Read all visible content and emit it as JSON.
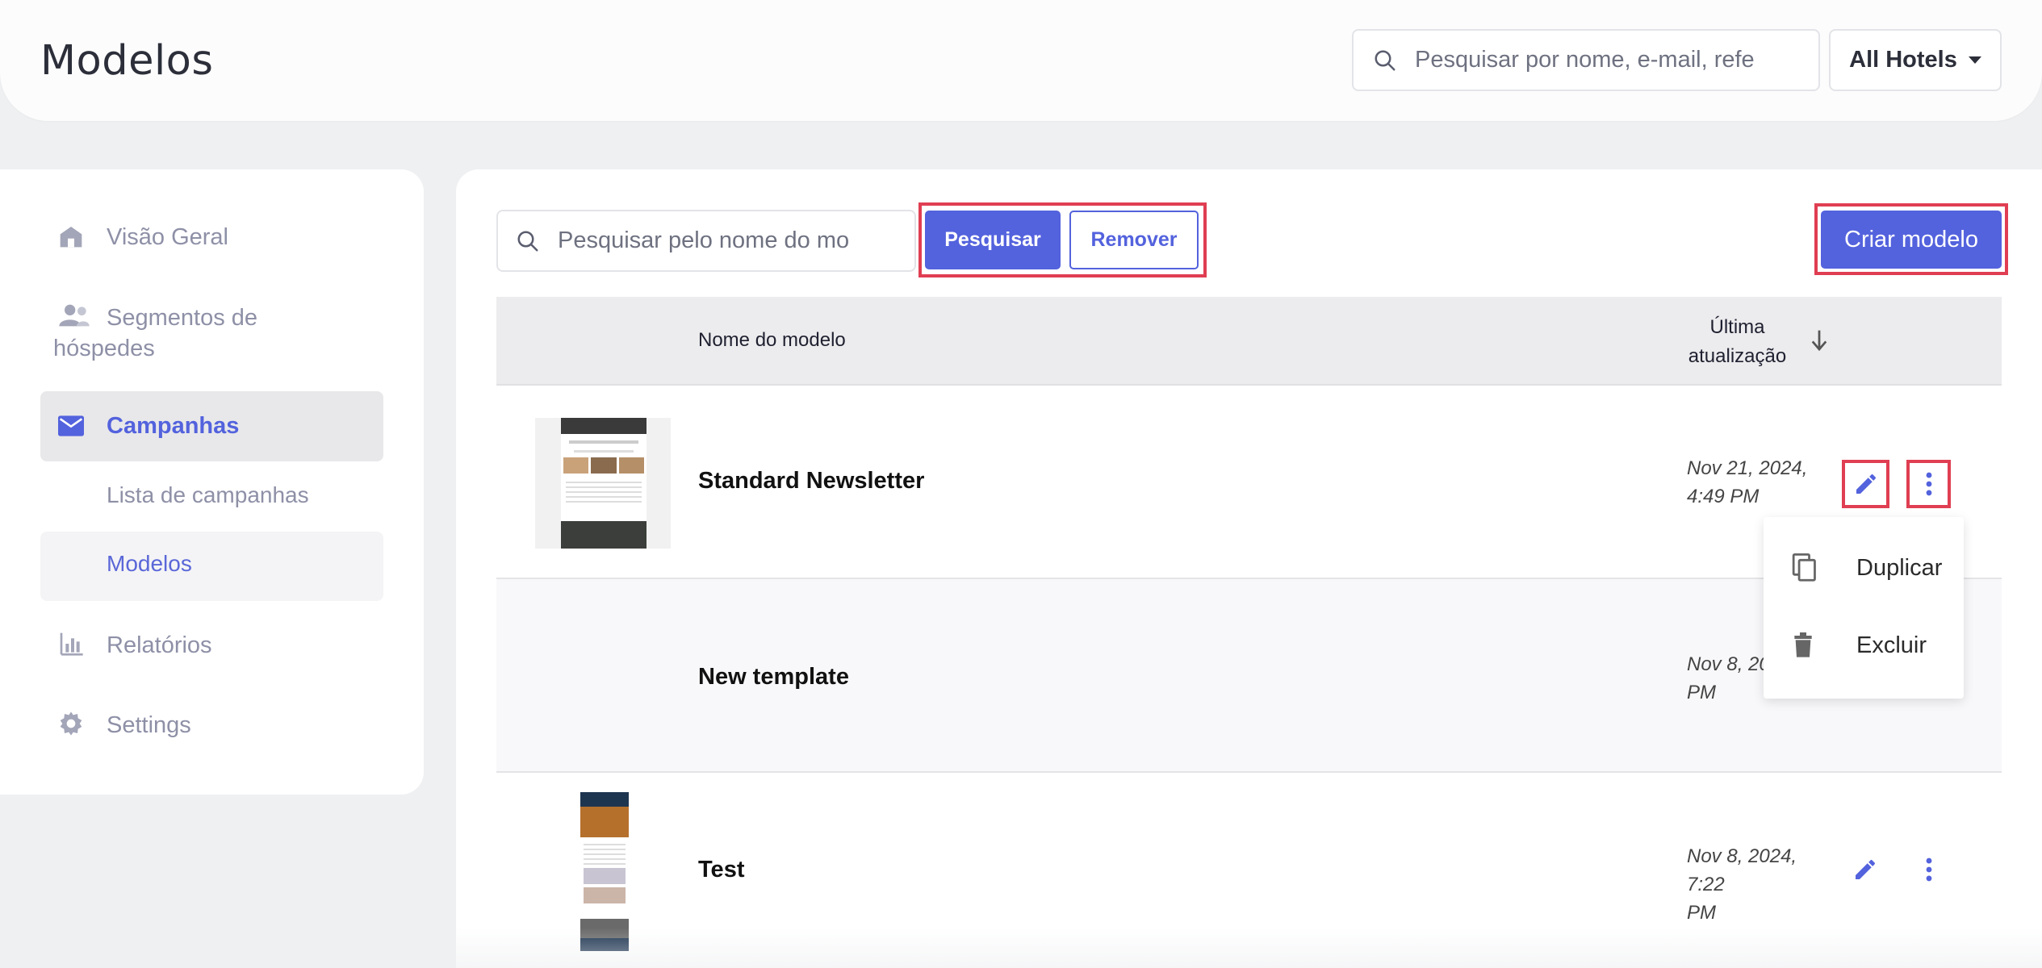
{
  "header": {
    "title": "Modelos",
    "search_placeholder": "Pesquisar por nome, e-mail, refe",
    "hotel_select": "All Hotels"
  },
  "sidebar": {
    "items": [
      {
        "label": "Visão Geral",
        "icon": "home-icon"
      },
      {
        "label": "Segmentos de",
        "label2": "hóspedes",
        "icon": "users-icon"
      },
      {
        "label": "Campanhas",
        "icon": "mail-icon",
        "active": true
      },
      {
        "label": "Lista de campanhas",
        "sub": true
      },
      {
        "label": "Modelos",
        "sub": true,
        "active": true
      },
      {
        "label": "Relatórios",
        "icon": "bar-chart-icon"
      },
      {
        "label": "Settings",
        "icon": "gear-icon"
      }
    ]
  },
  "toolbar": {
    "search_placeholder": "Pesquisar pelo nome do mo",
    "search_button": "Pesquisar",
    "remove_button": "Remover",
    "create_button": "Criar modelo"
  },
  "table": {
    "columns": {
      "name": "Nome do modelo",
      "updated_line1": "Última",
      "updated_line2": "atualização"
    },
    "rows": [
      {
        "name": "Standard Newsletter",
        "date_line1": "Nov 21, 2024,",
        "date_line2": "4:49 PM"
      },
      {
        "name": "New template",
        "date_line1": "Nov 8, 20",
        "date_line2": "PM"
      },
      {
        "name": "Test",
        "date_line1": "Nov 8, 2024, 7:22",
        "date_line2": "PM"
      }
    ]
  },
  "menu": {
    "duplicate": "Duplicar",
    "delete": "Excluir"
  },
  "colors": {
    "accent": "#5362dd",
    "highlight": "#e03e52",
    "muted": "#8e90a7"
  }
}
